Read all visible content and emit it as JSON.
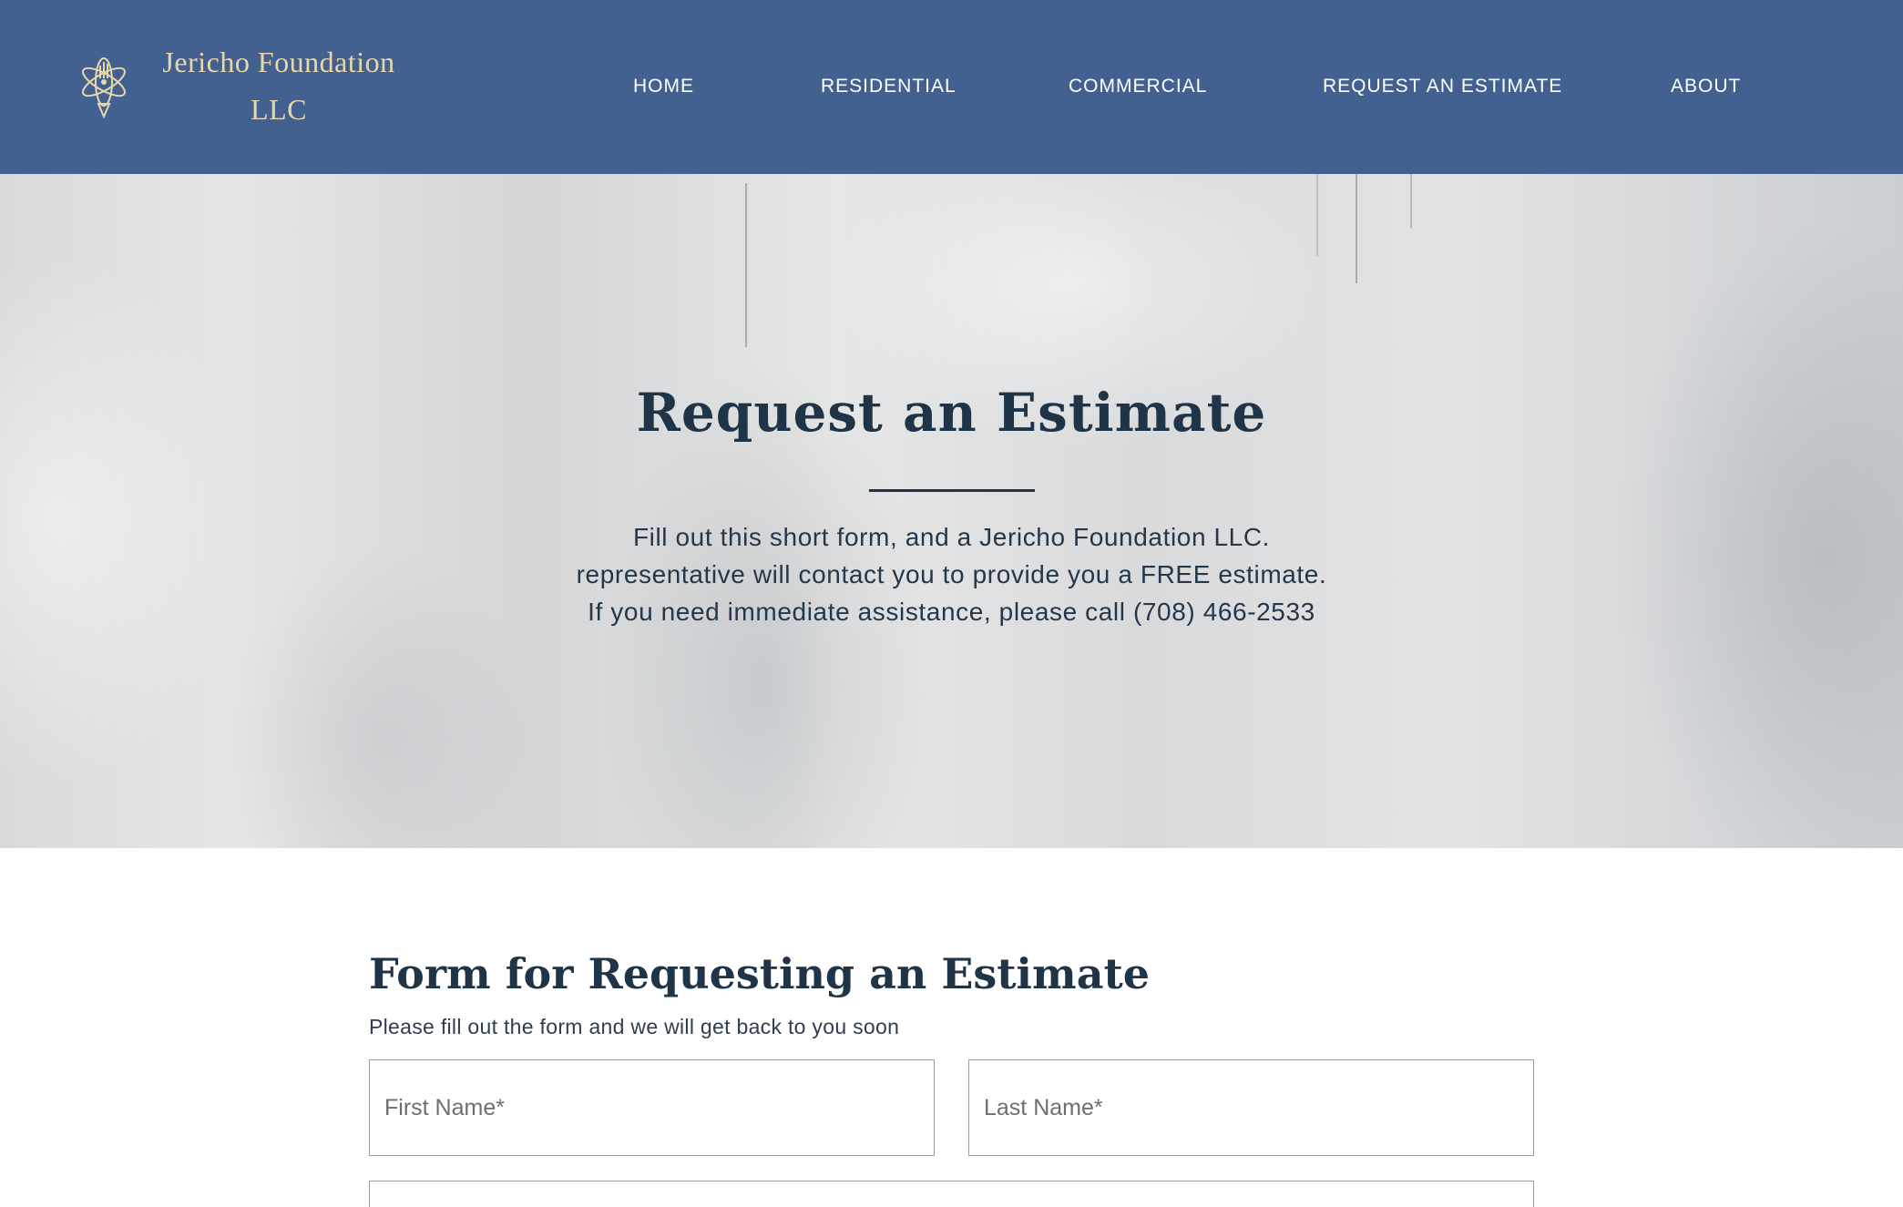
{
  "header": {
    "brand_line1": "Jericho Foundation",
    "brand_line2": "LLC",
    "logo_icon": "atom-hand-logo-icon",
    "nav": [
      {
        "label": "HOME"
      },
      {
        "label": "RESIDENTIAL"
      },
      {
        "label": "COMMERCIAL"
      },
      {
        "label": "REQUEST AN ESTIMATE"
      },
      {
        "label": "ABOUT"
      }
    ],
    "colors": {
      "background": "#426190",
      "brand_text": "#e8d7a8",
      "nav_text": "#ffffff"
    }
  },
  "hero": {
    "title": "Request an Estimate",
    "lines": [
      "Fill out this short form, and a Jericho Foundation LLC.",
      "representative will contact you to provide you a FREE estimate.",
      "If you need immediate assistance, please call (708) 466-2533"
    ],
    "colors": {
      "text": "#1f3447",
      "background": "#dcdddf"
    }
  },
  "form": {
    "title": "Form for Requesting an Estimate",
    "subtitle": "Please fill out the form and we will get back to you soon",
    "fields": {
      "first_name": {
        "placeholder": "First Name*",
        "value": ""
      },
      "last_name": {
        "placeholder": "Last Name*",
        "value": ""
      },
      "next_field": {
        "placeholder": "",
        "value": ""
      }
    }
  }
}
